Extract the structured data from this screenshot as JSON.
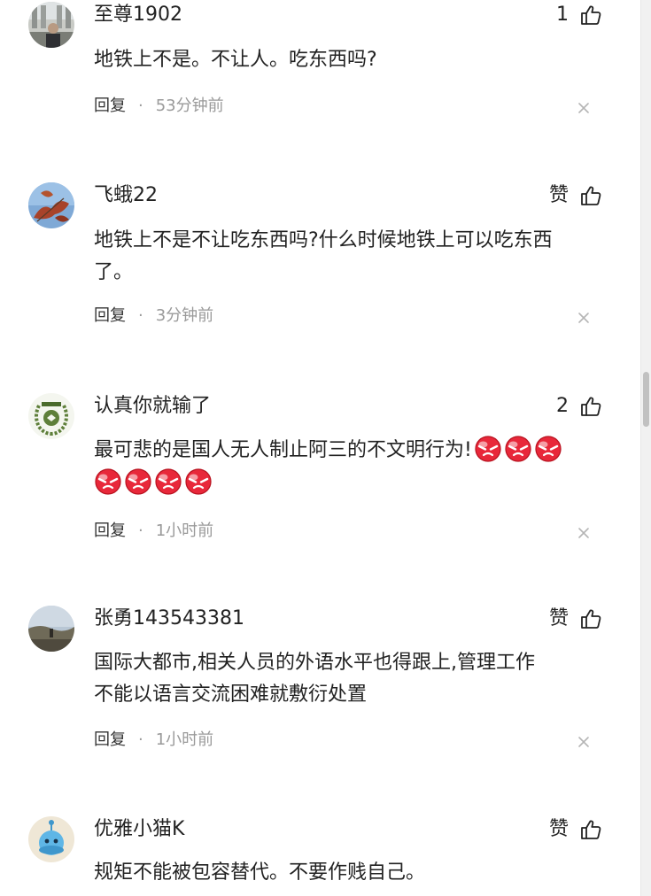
{
  "comments": [
    {
      "username": "至尊1902",
      "like_label": "1",
      "text_lines": [
        "地铁上不是。不让人。吃东西吗?"
      ],
      "emoji_count": 0,
      "reply_label": "回复",
      "separator": "·",
      "timestamp": "53分钟前"
    },
    {
      "username": "飞蛾22",
      "like_label": "赞",
      "text_lines": [
        "地铁上不是不让吃东西吗?什么时候地铁上可以吃东西",
        "了。"
      ],
      "emoji_count": 0,
      "reply_label": "回复",
      "separator": "·",
      "timestamp": "3分钟前"
    },
    {
      "username": "认真你就输了",
      "like_label": "2",
      "text_lines": [
        "最可悲的是国人无人制止阿三的不文明行为!"
      ],
      "emoji_count": 7,
      "emoji_name": "angry-face",
      "reply_label": "回复",
      "separator": "·",
      "timestamp": "1小时前"
    },
    {
      "username": "张勇143543381",
      "like_label": "赞",
      "text_lines": [
        "国际大都市,相关人员的外语水平也得跟上,管理工作",
        "不能以语言交流困难就敷衍处置"
      ],
      "emoji_count": 0,
      "reply_label": "回复",
      "separator": "·",
      "timestamp": "1小时前"
    },
    {
      "username": "优雅小猫K",
      "like_label": "赞",
      "text_lines": [
        "规矩不能被包容替代。不要作贱自己。"
      ],
      "emoji_count": 0
    }
  ],
  "colors": {
    "text": "#222222",
    "muted": "#9a9a9a",
    "emoji_red": "#e8283a"
  }
}
